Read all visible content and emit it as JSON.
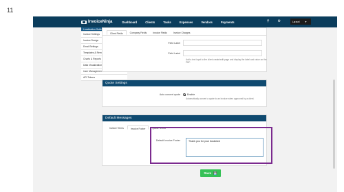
{
  "slide_number": "11",
  "brand": {
    "name": "InvoiceNinja"
  },
  "nav": [
    "Dashboard",
    "Clients",
    "Tasks",
    "Expenses",
    "Vendors",
    "Payments"
  ],
  "user_menu": {
    "label": "Laravel"
  },
  "sidebar": {
    "items": [
      "Localization Settings",
      "Invoice Settings",
      "Invoice Design",
      "Email Settings",
      "Templates & Reminders",
      "Charts & Reports",
      "Data Visualizations",
      "User Management",
      "API Tokens"
    ]
  },
  "fields_panel": {
    "tabs": [
      "Client Fields",
      "Company Fields",
      "Invoice Fields",
      "Invoice Charges"
    ],
    "field_label_1": "Field Label",
    "field_label_2": "Field Label",
    "help_text": "Add a text input to the client create/edit page and display the label and value on the PDF."
  },
  "quote_panel": {
    "title": "Quote Settings",
    "auto_convert_label": "Auto convert quote",
    "radio_label": "Enable",
    "help_text": "Automatically convert a quote to an invoice when approved by a client."
  },
  "messages_panel": {
    "title": "Default Messages",
    "tabs": [
      "Invoice Terms",
      "Invoice Footer",
      "Quote Terms"
    ],
    "footer_label": "Default Invoice Footer",
    "footer_value": "Thank you for your business!"
  },
  "save_button": {
    "label": "Save"
  },
  "colors": {
    "topbar": "#0b3d5c",
    "panel_header": "#0f4a70",
    "highlight": "#7b2a8e",
    "save": "#36c157"
  }
}
